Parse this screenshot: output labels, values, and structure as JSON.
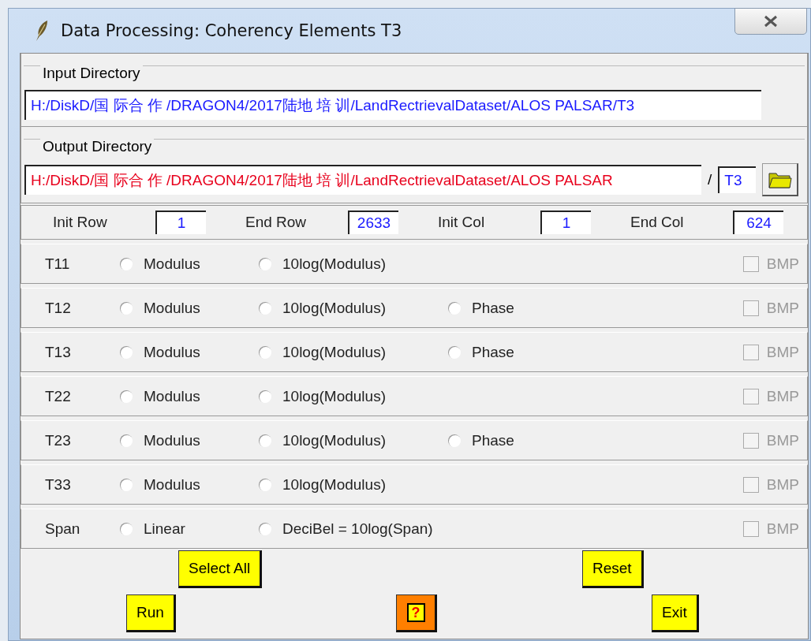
{
  "window": {
    "title": "Data Processing: Coherency Elements T3"
  },
  "input_directory": {
    "label": "Input Directory",
    "value": "H:/DiskD/国 际合 作 /DRAGON4/2017陆地 培 训/LandRectrievalDataset/ALOS PALSAR/T3"
  },
  "output_directory": {
    "label": "Output Directory",
    "value": "H:/DiskD/国 际合 作 /DRAGON4/2017陆地 培 训/LandRectrievalDataset/ALOS PALSAR",
    "separator": "/",
    "suffix": "T3"
  },
  "range": [
    {
      "label": "Init Row",
      "value": "1"
    },
    {
      "label": "End Row",
      "value": "2633"
    },
    {
      "label": "Init Col",
      "value": "1"
    },
    {
      "label": "End Col",
      "value": "624"
    }
  ],
  "elements": [
    {
      "label": "T11",
      "options": [
        {
          "label": "Modulus",
          "selected": false
        },
        {
          "label": "10log(Modulus)",
          "selected": false
        }
      ],
      "bmp": {
        "label": "BMP",
        "checked": false,
        "disabled": true
      }
    },
    {
      "label": "T12",
      "options": [
        {
          "label": "Modulus",
          "selected": false
        },
        {
          "label": "10log(Modulus)",
          "selected": false
        },
        {
          "label": "Phase",
          "selected": false
        }
      ],
      "bmp": {
        "label": "BMP",
        "checked": false,
        "disabled": true
      }
    },
    {
      "label": "T13",
      "options": [
        {
          "label": "Modulus",
          "selected": false
        },
        {
          "label": "10log(Modulus)",
          "selected": false
        },
        {
          "label": "Phase",
          "selected": false
        }
      ],
      "bmp": {
        "label": "BMP",
        "checked": false,
        "disabled": true
      }
    },
    {
      "label": "T22",
      "options": [
        {
          "label": "Modulus",
          "selected": false
        },
        {
          "label": "10log(Modulus)",
          "selected": false
        }
      ],
      "bmp": {
        "label": "BMP",
        "checked": false,
        "disabled": true
      }
    },
    {
      "label": "T23",
      "options": [
        {
          "label": "Modulus",
          "selected": false
        },
        {
          "label": "10log(Modulus)",
          "selected": false
        },
        {
          "label": "Phase",
          "selected": false
        }
      ],
      "bmp": {
        "label": "BMP",
        "checked": false,
        "disabled": true
      }
    },
    {
      "label": "T33",
      "options": [
        {
          "label": "Modulus",
          "selected": false
        },
        {
          "label": "10log(Modulus)",
          "selected": false
        }
      ],
      "bmp": {
        "label": "BMP",
        "checked": false,
        "disabled": true
      }
    },
    {
      "label": "Span",
      "options": [
        {
          "label": "Linear",
          "selected": false
        },
        {
          "label": "DeciBel = 10log(Span)",
          "selected": false
        }
      ],
      "bmp": {
        "label": "BMP",
        "checked": false,
        "disabled": true
      }
    }
  ],
  "buttons": {
    "select_all": "Select All",
    "reset": "Reset",
    "run": "Run",
    "help": "?",
    "exit": "Exit"
  }
}
